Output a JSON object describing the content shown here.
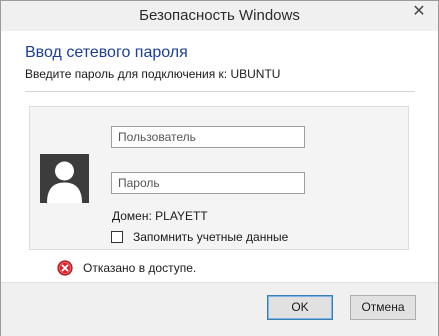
{
  "window": {
    "title": "Безопасность Windows",
    "close_glyph": "✕"
  },
  "dialog": {
    "heading": "Ввод сетевого пароля",
    "subheading": "Введите пароль для подключения к: UBUNTU"
  },
  "credentials": {
    "username": {
      "value": "",
      "placeholder": "Пользователь"
    },
    "password": {
      "value": "",
      "placeholder": "Пароль"
    },
    "domain_text": "Домен: PLAYETT",
    "remember_label": "Запомнить учетные данные",
    "remember_checked": false,
    "avatar_icon": "user-silhouette-icon"
  },
  "status": {
    "icon": "error-icon",
    "message": "Отказано в доступе."
  },
  "buttons": {
    "ok_label": "OK",
    "cancel_label": "Отмена"
  },
  "colors": {
    "heading": "#1c3f95",
    "avatar_bg": "#3c3c3c",
    "error_red": "#d9262c",
    "default_button_border": "#3c7fb1"
  }
}
